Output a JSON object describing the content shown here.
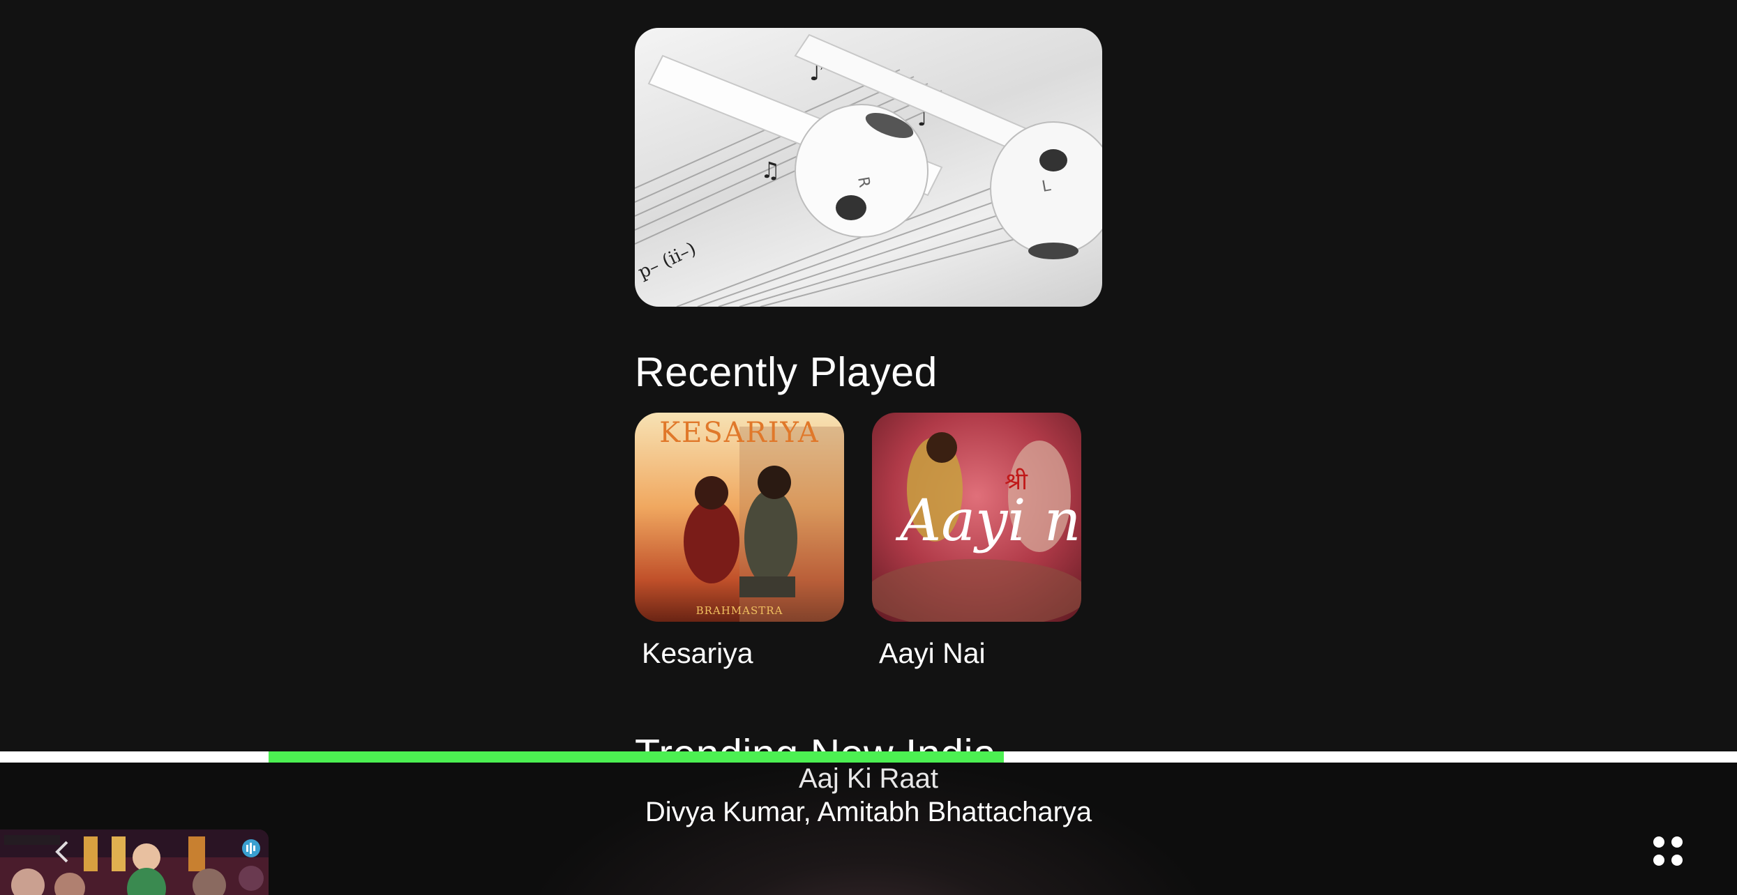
{
  "banner": {
    "alt_icon": "earbuds-sheet-music-image"
  },
  "recently_played": {
    "title": "Recently Played",
    "items": [
      {
        "label": "Kesariya",
        "art_text": "KESARIYA",
        "art_subtext": "BRAHMASTRA"
      },
      {
        "label": "Aayi Nai",
        "art_text": "Aayi na"
      }
    ]
  },
  "trending": {
    "title": "Trending Now India"
  },
  "now_playing": {
    "title": "Aaj Ki Raat",
    "artist": "Divya Kumar, Amitabh Bhattacharya",
    "progress": 0.65
  },
  "colors": {
    "background": "#121212",
    "accent": "#4cf052",
    "text": "#ffffff"
  }
}
